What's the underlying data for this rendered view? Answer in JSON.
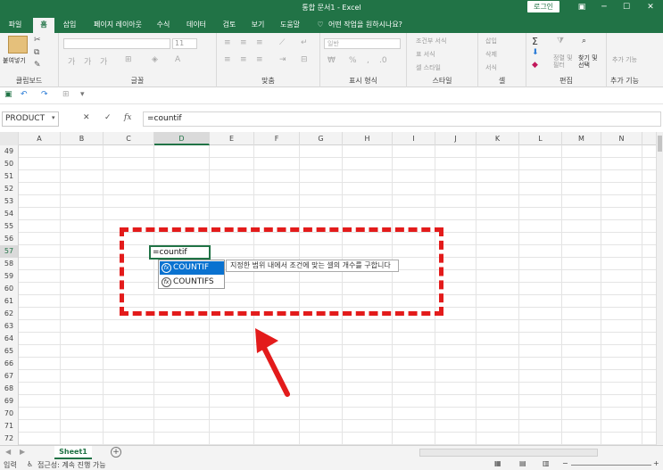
{
  "window": {
    "title": "통합 문서1 - Excel",
    "login": "로그인"
  },
  "tabs": [
    "파일",
    "홈",
    "삽입",
    "페이지 레이아웃",
    "수식",
    "데이터",
    "검토",
    "보기",
    "도움말"
  ],
  "tell_me": "어떤 작업을 원하시나요?",
  "ribbon": {
    "clipboard": {
      "paste": "붙여넣기",
      "label": "클립보드"
    },
    "font": {
      "label": "글꼴",
      "size": "11"
    },
    "align": {
      "label": "맞춤"
    },
    "number": {
      "label": "표시 형식",
      "format": "일반"
    },
    "styles": {
      "label": "스타일",
      "cond": "조건부 서식",
      "table": "표 서식",
      "cell": "셀 스타일"
    },
    "cells": {
      "label": "셀",
      "insert": "삽입",
      "delete": "삭제",
      "format": "서식"
    },
    "editing": {
      "label": "편집",
      "sort": "정렬 및 필터",
      "find": "찾기 및 선택"
    },
    "addins": {
      "label": "추가 기능",
      "btn": "추가 기능"
    }
  },
  "formula_bar": {
    "name_box": "PRODUCT",
    "formula": "=countif",
    "fx": "fx"
  },
  "columns": [
    "A",
    "B",
    "C",
    "D",
    "E",
    "F",
    "G",
    "H",
    "I",
    "J",
    "K",
    "L",
    "M",
    "N"
  ],
  "rows": [
    "49",
    "50",
    "51",
    "52",
    "53",
    "54",
    "55",
    "56",
    "57",
    "58",
    "59",
    "60",
    "61",
    "62",
    "63",
    "64",
    "65",
    "66",
    "67",
    "68",
    "69",
    "70",
    "71",
    "72"
  ],
  "cell_edit": "=countif",
  "autocomplete": [
    {
      "name": "COUNTIF"
    },
    {
      "name": "COUNTIFS"
    }
  ],
  "tooltip": "지정한 범위 내에서 조건에 맞는 셀의 개수를 구합니다",
  "sheet": {
    "tab": "Sheet1"
  },
  "status": {
    "mode": "입력",
    "accessibility": "접근성: 계속 진행 가능"
  },
  "colors": {
    "accent": "#217346",
    "annotation": "#e31b1b",
    "highlight": "#0a72d0"
  }
}
